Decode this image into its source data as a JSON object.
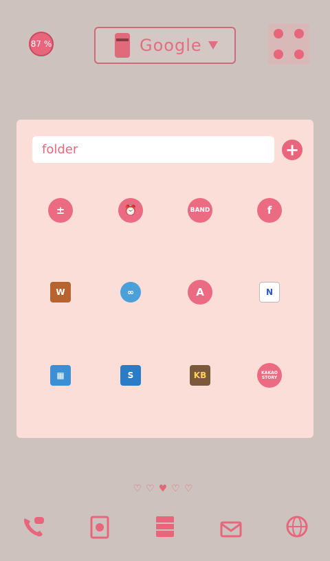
{
  "status": {
    "battery_label": "87 %"
  },
  "search_widget": {
    "label": "Google"
  },
  "folder": {
    "name": "folder",
    "apps": [
      {
        "icon": "calculator-icon",
        "glyph": "±"
      },
      {
        "icon": "alarm-clock-icon",
        "glyph": "⏰"
      },
      {
        "icon": "band-icon",
        "glyph": "BAND"
      },
      {
        "icon": "facebook-icon",
        "glyph": "f"
      },
      {
        "icon": "wallet-icon",
        "glyph": "W"
      },
      {
        "icon": "go-launcher-icon",
        "glyph": "∞"
      },
      {
        "icon": "a-app-icon",
        "glyph": "A"
      },
      {
        "icon": "naver-icon",
        "glyph": "N"
      },
      {
        "icon": "multi-app-icon",
        "glyph": "▦"
      },
      {
        "icon": "s-app-icon",
        "glyph": "S"
      },
      {
        "icon": "kb-bank-icon",
        "glyph": "KB"
      },
      {
        "icon": "kakao-story-icon",
        "glyph": "KAKAO STORY"
      }
    ]
  },
  "page_indicator": {
    "dots": "♡♡♥♡♡"
  },
  "dock": [
    {
      "icon": "phone-icon",
      "glyph": "✆"
    },
    {
      "icon": "contacts-icon",
      "glyph": "☺"
    },
    {
      "icon": "drawer-icon",
      "glyph": "▤"
    },
    {
      "icon": "mail-icon",
      "glyph": "✉"
    },
    {
      "icon": "globe-icon",
      "glyph": "◎"
    }
  ],
  "colors": {
    "accent": "#e8667c",
    "background": "#cdc2bd",
    "panel": "#fbded8"
  }
}
